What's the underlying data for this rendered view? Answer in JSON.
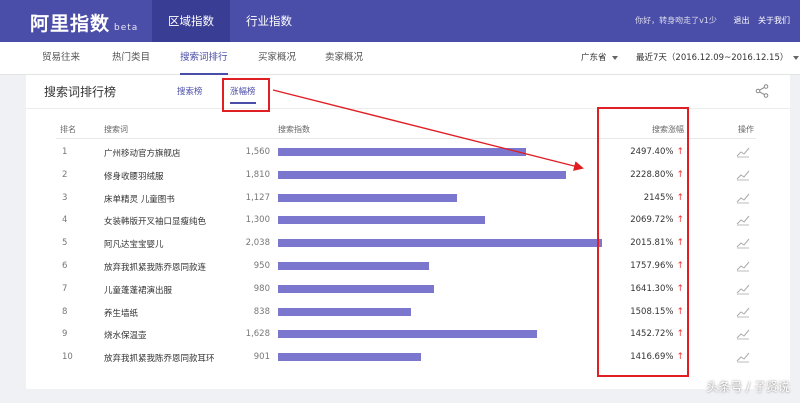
{
  "header": {
    "logo": "阿里指数",
    "beta": "beta",
    "tabs": [
      "区域指数",
      "行业指数"
    ],
    "greeting": "你好，转身吻走了v1少",
    "logout": "退出",
    "about": "关于我们"
  },
  "subnav": {
    "items": [
      "贸易往来",
      "热门类目",
      "搜索词排行",
      "买家概况",
      "卖家概况"
    ],
    "active": "搜索词排行",
    "region": "广东省",
    "date_range": "最近7天（2016.12.09~2016.12.15）"
  },
  "card": {
    "title": "搜索词排行榜",
    "tabs": [
      "搜索榜",
      "涨幅榜"
    ],
    "active_tab": "涨幅榜"
  },
  "table": {
    "columns": [
      "排名",
      "搜索词",
      "搜索指数",
      "搜索涨幅",
      "操作"
    ],
    "max_index": 2200,
    "rows": [
      {
        "rank": "1",
        "keyword": "广州移动官方旗舰店",
        "index": 1560,
        "index_label": "1,560",
        "growth": "2497.40%"
      },
      {
        "rank": "2",
        "keyword": "修身收腰羽绒服",
        "index": 1810,
        "index_label": "1,810",
        "growth": "2228.80%"
      },
      {
        "rank": "3",
        "keyword": "床单精灵 儿童图书",
        "index": 1127,
        "index_label": "1,127",
        "growth": "2145%"
      },
      {
        "rank": "4",
        "keyword": "女装韩版开叉袖口显瘦纯色",
        "index": 1300,
        "index_label": "1,300",
        "growth": "2069.72%"
      },
      {
        "rank": "5",
        "keyword": "阿凡达宝宝婴儿",
        "index": 2038,
        "index_label": "2,038",
        "growth": "2015.81%"
      },
      {
        "rank": "6",
        "keyword": "放弃我抓紧我陈乔恩同款连",
        "index": 950,
        "index_label": "950",
        "growth": "1757.96%"
      },
      {
        "rank": "7",
        "keyword": "儿童蓬蓬裙演出服",
        "index": 980,
        "index_label": "980",
        "growth": "1641.30%"
      },
      {
        "rank": "8",
        "keyword": "养生墙纸",
        "index": 838,
        "index_label": "838",
        "growth": "1508.15%"
      },
      {
        "rank": "9",
        "keyword": "烧水保温壶",
        "index": 1628,
        "index_label": "1,628",
        "growth": "1452.72%"
      },
      {
        "rank": "10",
        "keyword": "放弃我抓紧我陈乔恩同款耳环",
        "index": 901,
        "index_label": "901",
        "growth": "1416.69%"
      }
    ],
    "up_symbol": "↑"
  },
  "colors": {
    "brand": "#4b4ea8",
    "bar": "#7b77cf",
    "annotation": "#e01f25",
    "up": "#e33333"
  },
  "watermark": "头条号 / 子贤说"
}
